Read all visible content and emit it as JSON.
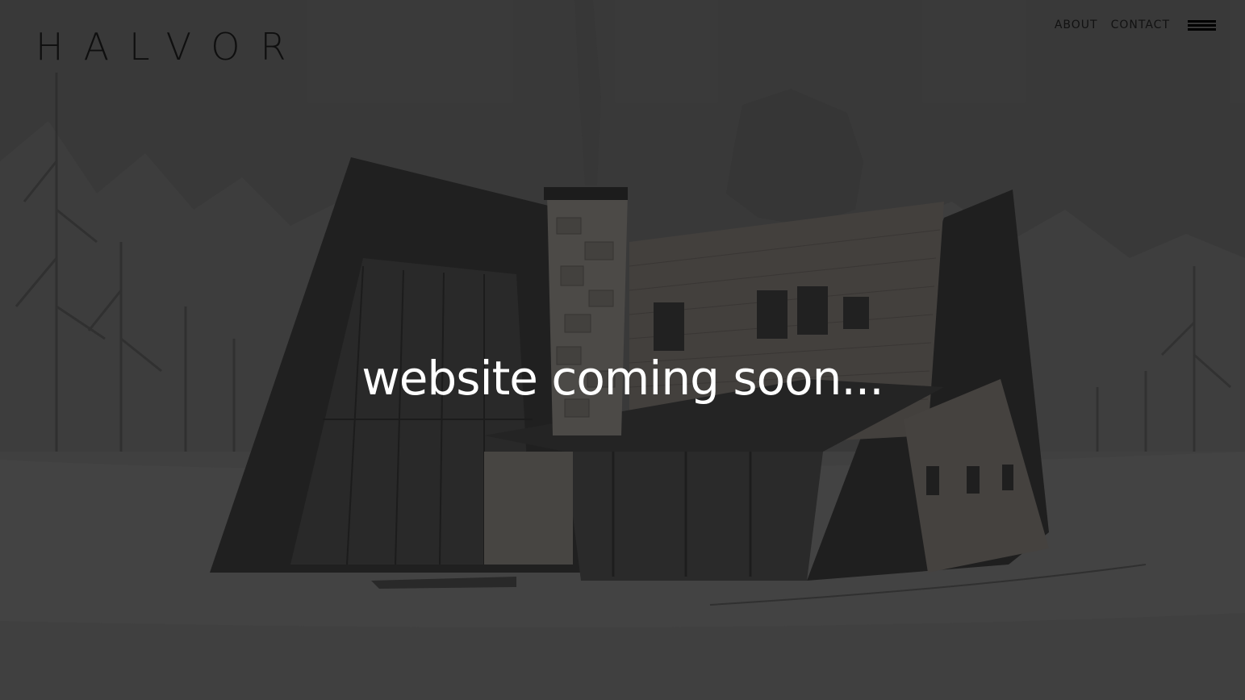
{
  "brand": {
    "logo_text": "HALVOR"
  },
  "nav": {
    "about_label": "ABOUT",
    "contact_label": "CONTACT",
    "menu_icon": "hamburger-menu-icon"
  },
  "hero": {
    "headline": "website coming soon...",
    "background_image": "a-frame-house-sketch-rendering"
  },
  "colors": {
    "background": "#3d3d3d",
    "headline_text": "#ffffff",
    "nav_text": "#111111",
    "logo_text": "#0f0f0f"
  }
}
